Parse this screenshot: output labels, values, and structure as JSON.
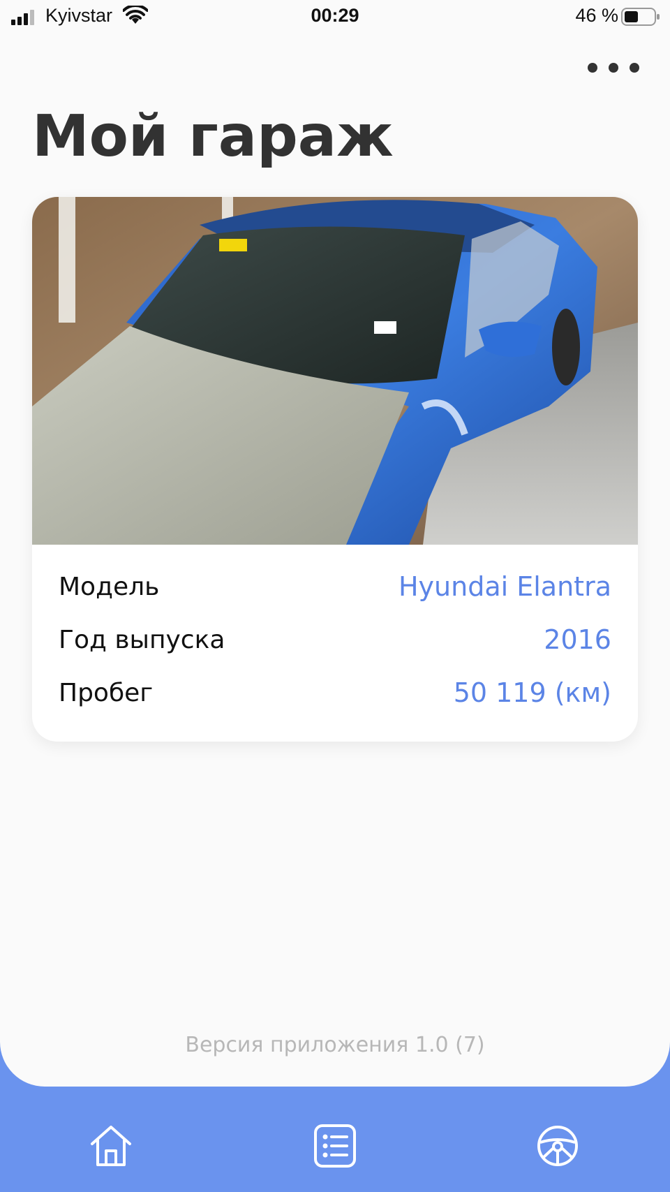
{
  "status_bar": {
    "carrier": "Kyivstar",
    "time": "00:29",
    "battery": "46 %"
  },
  "header": {
    "title": "Мой гараж",
    "more_icon": "more-horizontal-icon"
  },
  "car": {
    "rows": [
      {
        "label": "Модель",
        "value": "Hyundai Elantra"
      },
      {
        "label": "Год выпуска",
        "value": "2016"
      },
      {
        "label": "Пробег",
        "value": "50 119 (км)"
      }
    ]
  },
  "footer": {
    "version": "Версия приложения 1.0 (7)"
  },
  "tab_bar": {
    "tabs": [
      {
        "icon": "home-icon"
      },
      {
        "icon": "list-icon"
      },
      {
        "icon": "steering-wheel-icon"
      }
    ]
  },
  "colors": {
    "accent": "#5b84e6",
    "tab_bar": "#6a93ee",
    "title": "#323232",
    "background": "#fafafa"
  }
}
